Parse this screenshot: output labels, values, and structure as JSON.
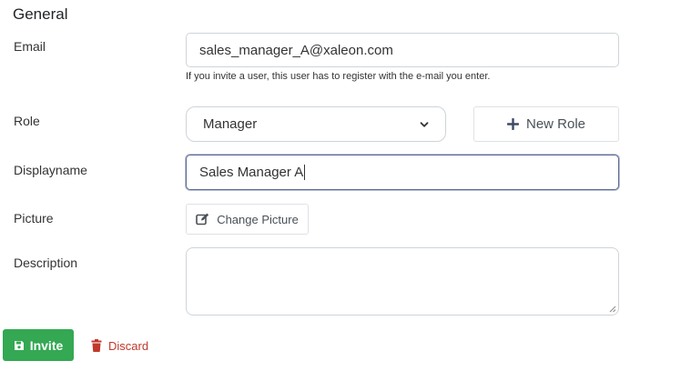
{
  "section": {
    "title": "General"
  },
  "email": {
    "label": "Email",
    "value": "sales_manager_A@xaleon.com",
    "help": "If you invite a user, this user has to register with the e-mail you enter."
  },
  "role": {
    "label": "Role",
    "selected": "Manager",
    "new_role_label": "New Role"
  },
  "displayname": {
    "label": "Displayname",
    "value": "Sales Manager A"
  },
  "picture": {
    "label": "Picture",
    "button_label": "Change Picture"
  },
  "description": {
    "label": "Description",
    "value": ""
  },
  "actions": {
    "invite_label": "Invite",
    "discard_label": "Discard"
  },
  "colors": {
    "invite": "#34a853",
    "discard": "#c0392b",
    "focus_border": "#5b6a91"
  },
  "icons": {
    "role_dropdown": "chevron-down-icon",
    "new_role": "plus-icon",
    "change_picture": "edit-icon",
    "invite": "save-icon",
    "discard": "trash-icon"
  }
}
